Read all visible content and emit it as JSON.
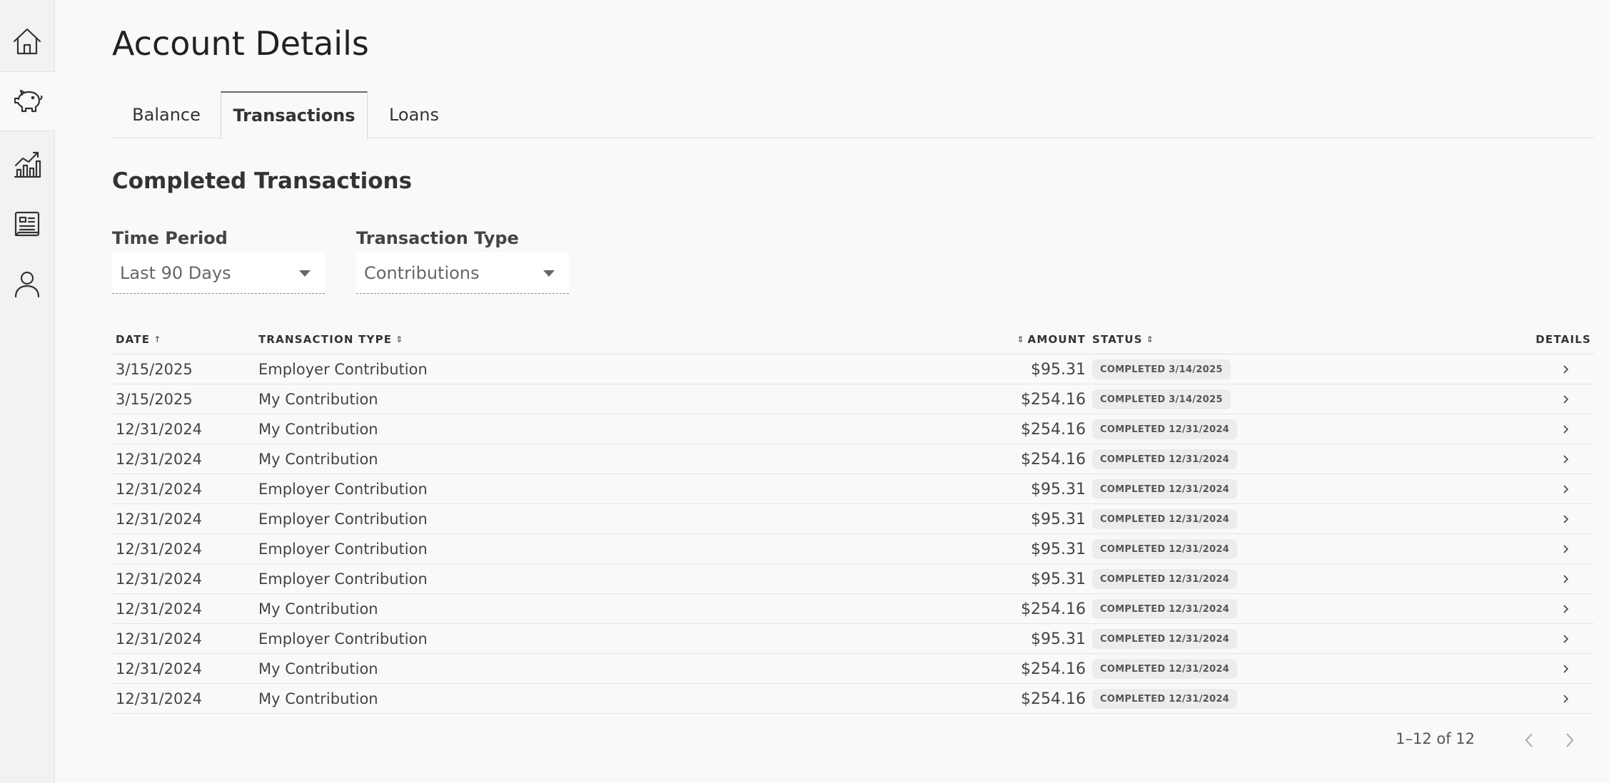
{
  "sidebar": {
    "items": [
      {
        "name": "home",
        "icon": "home-icon"
      },
      {
        "name": "savings",
        "icon": "piggy-bank-icon",
        "active": true
      },
      {
        "name": "investments",
        "icon": "chart-icon"
      },
      {
        "name": "documents",
        "icon": "document-icon"
      },
      {
        "name": "profile",
        "icon": "user-icon"
      }
    ]
  },
  "page": {
    "title": "Account Details"
  },
  "tabs": [
    {
      "label": "Balance"
    },
    {
      "label": "Transactions",
      "active": true
    },
    {
      "label": "Loans"
    }
  ],
  "section": {
    "title": "Completed Transactions"
  },
  "filters": {
    "time_period": {
      "label": "Time Period",
      "value": "Last 90 Days"
    },
    "transaction_type": {
      "label": "Transaction Type",
      "value": "Contributions"
    }
  },
  "table": {
    "columns": {
      "date": "DATE",
      "type": "TRANSACTION TYPE",
      "amount": "AMOUNT",
      "status": "STATUS",
      "details": "DETAILS"
    },
    "rows": [
      {
        "date": "3/15/2025",
        "type": "Employer Contribution",
        "amount": "$95.31",
        "status": "COMPLETED 3/14/2025"
      },
      {
        "date": "3/15/2025",
        "type": "My Contribution",
        "amount": "$254.16",
        "status": "COMPLETED 3/14/2025"
      },
      {
        "date": "12/31/2024",
        "type": "My Contribution",
        "amount": "$254.16",
        "status": "COMPLETED 12/31/2024"
      },
      {
        "date": "12/31/2024",
        "type": "My Contribution",
        "amount": "$254.16",
        "status": "COMPLETED 12/31/2024"
      },
      {
        "date": "12/31/2024",
        "type": "Employer Contribution",
        "amount": "$95.31",
        "status": "COMPLETED 12/31/2024"
      },
      {
        "date": "12/31/2024",
        "type": "Employer Contribution",
        "amount": "$95.31",
        "status": "COMPLETED 12/31/2024"
      },
      {
        "date": "12/31/2024",
        "type": "Employer Contribution",
        "amount": "$95.31",
        "status": "COMPLETED 12/31/2024"
      },
      {
        "date": "12/31/2024",
        "type": "Employer Contribution",
        "amount": "$95.31",
        "status": "COMPLETED 12/31/2024"
      },
      {
        "date": "12/31/2024",
        "type": "My Contribution",
        "amount": "$254.16",
        "status": "COMPLETED 12/31/2024"
      },
      {
        "date": "12/31/2024",
        "type": "Employer Contribution",
        "amount": "$95.31",
        "status": "COMPLETED 12/31/2024"
      },
      {
        "date": "12/31/2024",
        "type": "My Contribution",
        "amount": "$254.16",
        "status": "COMPLETED 12/31/2024"
      },
      {
        "date": "12/31/2024",
        "type": "My Contribution",
        "amount": "$254.16",
        "status": "COMPLETED 12/31/2024"
      }
    ]
  },
  "pagination": {
    "info": "1–12 of 12"
  }
}
